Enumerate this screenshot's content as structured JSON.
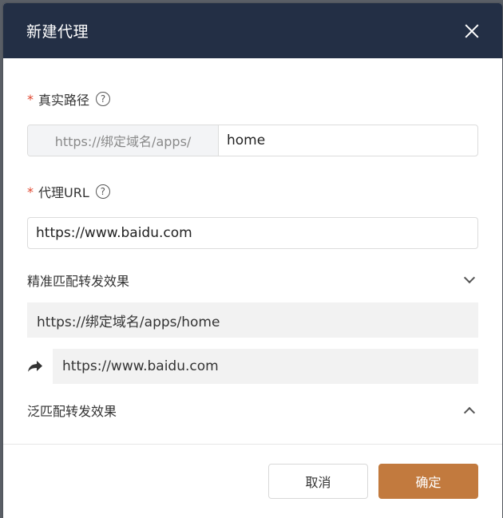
{
  "dialog": {
    "title": "新建代理",
    "close_icon": "close-icon"
  },
  "real_path": {
    "required_mark": "*",
    "label": "真实路径",
    "help": "?",
    "prefix": "https://绑定域名/apps/",
    "value": "home"
  },
  "proxy_url": {
    "required_mark": "*",
    "label": "代理URL",
    "help": "?",
    "value": "https://www.baidu.com"
  },
  "exact_match": {
    "label": "精准匹配转发效果",
    "expanded": true,
    "source": "https://绑定域名/apps/home",
    "target": "https://www.baidu.com",
    "forward_icon": "share-forward-icon"
  },
  "wildcard_match": {
    "label": "泛匹配转发效果",
    "expanded": false
  },
  "footer": {
    "cancel_label": "取消",
    "ok_label": "确定"
  },
  "colors": {
    "header_bg": "#232f45",
    "accent": "#c27a3e",
    "required": "#e0462e"
  }
}
